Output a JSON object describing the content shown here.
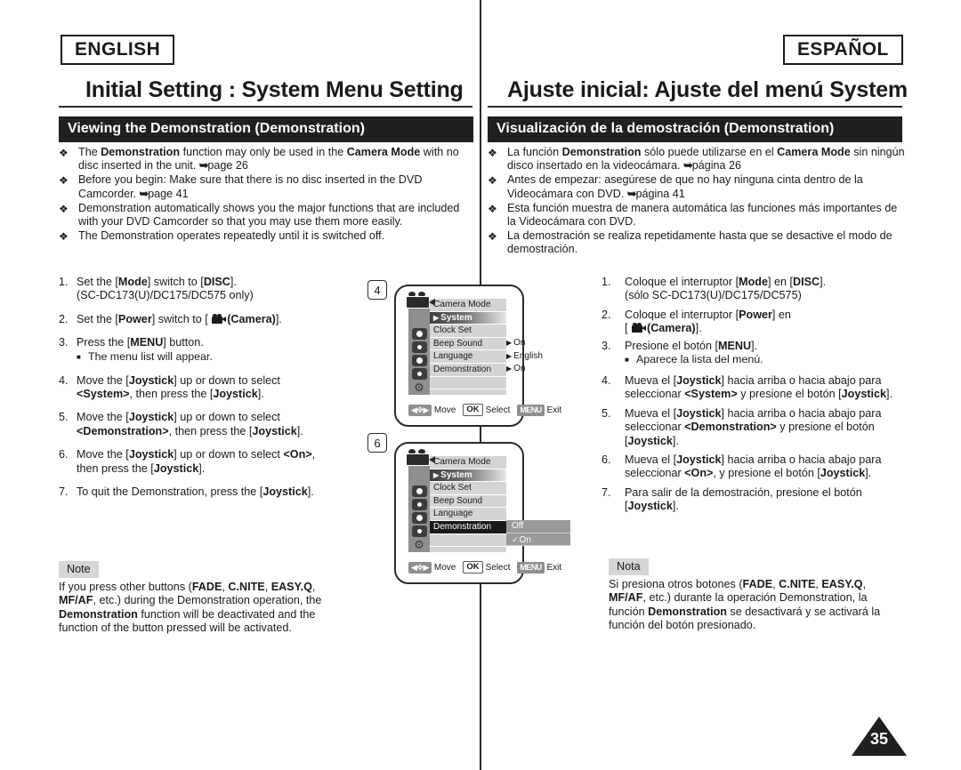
{
  "languages": {
    "english": "ENGLISH",
    "spanish": "ESPAÑOL"
  },
  "titles": {
    "english": "Initial Setting : System Menu Setting",
    "spanish": "Ajuste inicial: Ajuste del menú System"
  },
  "banners": {
    "english": "Viewing the Demonstration (Demonstration)",
    "spanish": "Visualización de la demostración (Demonstration)"
  },
  "bullets_en": [
    "The <b>Demonstration</b> function may only be used in the <b>Camera Mode</b> with no disc inserted in the unit. <span class=\"arr\">➥</span>page 26",
    "Before you begin: Make sure that there is no disc inserted in the DVD Camcorder. <span class=\"arr\">➥</span>page 41",
    "Demonstration automatically shows you the major functions that are included with your DVD Camcorder so that you may use them more easily.",
    "The Demonstration operates repeatedly until it is switched off."
  ],
  "bullets_es": [
    "La función <b>Demonstration</b> sólo puede utilizarse en el <b>Camera Mode</b> sin ningún disco insertado en la videocámara. <span class=\"arr\">➥</span>página 26",
    "Antes de empezar: asegúrese de que no hay ninguna cinta dentro de la Videocámara con DVD. <span class=\"arr\">➥</span>página 41",
    "Esta función muestra de manera automática las funciones más importantes de la Videocámara con DVD.",
    "La demostración se realiza repetidamente hasta que se desactive el modo de demostración."
  ],
  "bullet_marker": "❖",
  "steps_en": [
    {
      "num": "1.",
      "html": "Set the [<b>Mode</b>] switch to [<b>DISC</b>].<br>(SC-DC173(U)/DC175/DC575 only)"
    },
    {
      "num": "2.",
      "html": "Set the [<b>Power</b>] switch to [ <span class=\"cam-glyph\"><span class=\"r1\"></span><span class=\"r2\"></span><span class=\"body\"></span><span class=\"lens\"></span></span><b>(Camera)</b>]."
    },
    {
      "num": "3.",
      "html": "Press the [<b>MENU</b>] button.",
      "sub": "The menu list will appear."
    },
    {
      "num": "4.",
      "html": "Move the [<b>Joystick</b>] up or down to select<br><b>&lt;System&gt;</b>, then press the [<b>Joystick</b>]."
    },
    {
      "num": "5.",
      "html": "Move the [<b>Joystick</b>] up or down to select<br><b>&lt;Demonstration&gt;</b>, then press the [<b>Joystick</b>]."
    },
    {
      "num": "6.",
      "html": "Move the [<b>Joystick</b>] up or down to select <b>&lt;On&gt;</b>,<br>then press the [<b>Joystick</b>]."
    },
    {
      "num": "7.",
      "html": "To quit the Demonstration, press the [<b>Joystick</b>]."
    }
  ],
  "steps_es": [
    {
      "num": "1.",
      "html": "Coloque el interruptor [<b>Mode</b>] en [<b>DISC</b>].<br>(sólo SC-DC173(U)/DC175/DC575)"
    },
    {
      "num": "2.",
      "html": "Coloque el interruptor [<b>Power</b>] en<br>[ <span class=\"cam-glyph\"><span class=\"r1\"></span><span class=\"r2\"></span><span class=\"body\"></span><span class=\"lens\"></span></span><b>(Camera)</b>]."
    },
    {
      "num": "3.",
      "html": "Presione el botón [<b>MENU</b>].",
      "sub": "Aparece la lista del menú."
    },
    {
      "num": "4.",
      "html": "Mueva el [<b>Joystick</b>] hacia arriba o hacia abajo para seleccionar <b>&lt;System&gt;</b> y presione el botón [<b>Joystick</b>]."
    },
    {
      "num": "5.",
      "html": "Mueva el [<b>Joystick</b>] hacia arriba o hacia abajo para seleccionar <b>&lt;Demonstration&gt;</b> y presione el botón [<b>Joystick</b>]."
    },
    {
      "num": "6.",
      "html": "Mueva el [<b>Joystick</b>] hacia arriba o hacia abajo para seleccionar <b>&lt;On&gt;</b>, y presione el botón [<b>Joystick</b>]."
    },
    {
      "num": "7.",
      "html": "Para salir de la demostración, presione el botón [<b>Joystick</b>]."
    }
  ],
  "markers": {
    "first": "4",
    "second": "6"
  },
  "lcd1": {
    "title": "Camera Mode",
    "rows": [
      {
        "label": "System",
        "state": "selected",
        "caret": true
      },
      {
        "label": "Clock Set",
        "state": "normal"
      },
      {
        "label": "Beep Sound",
        "state": "normal"
      },
      {
        "label": "Language",
        "state": "normal"
      },
      {
        "label": "Demonstration",
        "state": "normal"
      }
    ],
    "values": [
      "",
      "",
      "On",
      "English",
      "On"
    ],
    "hint": {
      "move": "Move",
      "ok": "OK",
      "select": "Select",
      "menu": "MENU",
      "exit": "Exit"
    }
  },
  "lcd2": {
    "title": "Camera Mode",
    "rows": [
      {
        "label": "System",
        "state": "selected",
        "caret": true
      },
      {
        "label": "Clock Set",
        "state": "normal"
      },
      {
        "label": "Beep Sound",
        "state": "normal"
      },
      {
        "label": "Language",
        "state": "normal"
      },
      {
        "label": "Demonstration",
        "state": "current"
      }
    ],
    "submenu": [
      {
        "label": "Off",
        "checked": false
      },
      {
        "label": "On",
        "checked": true
      }
    ],
    "hint": {
      "move": "Move",
      "ok": "OK",
      "select": "Select",
      "menu": "MENU",
      "exit": "Exit"
    }
  },
  "note_en": {
    "label": "Note",
    "body": "If you press other buttons (<b>FADE</b>, <b>C.NITE</b>, <b>EASY.Q</b>, <b>MF/AF</b>, etc.) during the Demonstration operation, the <b>Demonstration</b> function will be deactivated and the function of the button pressed will be activated."
  },
  "note_es": {
    "label": "Nota",
    "body": "Si presiona otros botones (<b>FADE</b>, <b>C.NITE</b>, <b>EASY.Q</b>, <b>MF/AF</b>, etc.) durante la operación Demonstration, la función <b>Demonstration</b> se desactivará y se activará la función del botón presionado."
  },
  "page_number": "35"
}
